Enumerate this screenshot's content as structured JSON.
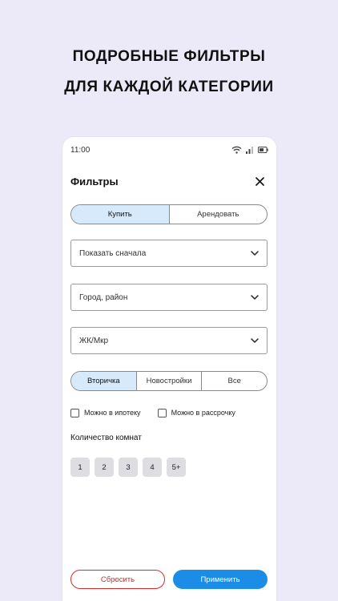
{
  "promo": {
    "line1": "ПОДРОБНЫЕ ФИЛЬТРЫ",
    "line2": "ДЛЯ КАЖДОЙ КАТЕГОРИИ"
  },
  "statusbar": {
    "time": "11:00"
  },
  "header": {
    "title": "Фильтры"
  },
  "deal_type": {
    "options": [
      "Купить",
      "Арендовать"
    ],
    "selected": "Купить"
  },
  "selects": {
    "sort": "Показать сначала",
    "city": "Город, район",
    "complex": "ЖК/Мкр"
  },
  "market": {
    "options": [
      "Вторичка",
      "Новостройки",
      "Все"
    ],
    "selected": "Вторичка"
  },
  "checkboxes": {
    "mortgage": {
      "label": "Можно в ипотеку",
      "checked": false
    },
    "installment": {
      "label": "Можно в рассрочку",
      "checked": false
    }
  },
  "rooms": {
    "label": "Количество комнат",
    "options": [
      "1",
      "2",
      "3",
      "4",
      "5+"
    ]
  },
  "actions": {
    "reset": "Сбросить",
    "apply": "Применить"
  },
  "colors": {
    "background": "#eceaf9",
    "active_segment": "#d7eafb",
    "apply": "#1c8de6",
    "reset": "#d52b2b"
  },
  "icons": {
    "wifi": "wifi-icon",
    "signal": "signal-icon",
    "battery": "battery-icon",
    "close": "close-icon",
    "chevron": "chevron-down-icon"
  }
}
